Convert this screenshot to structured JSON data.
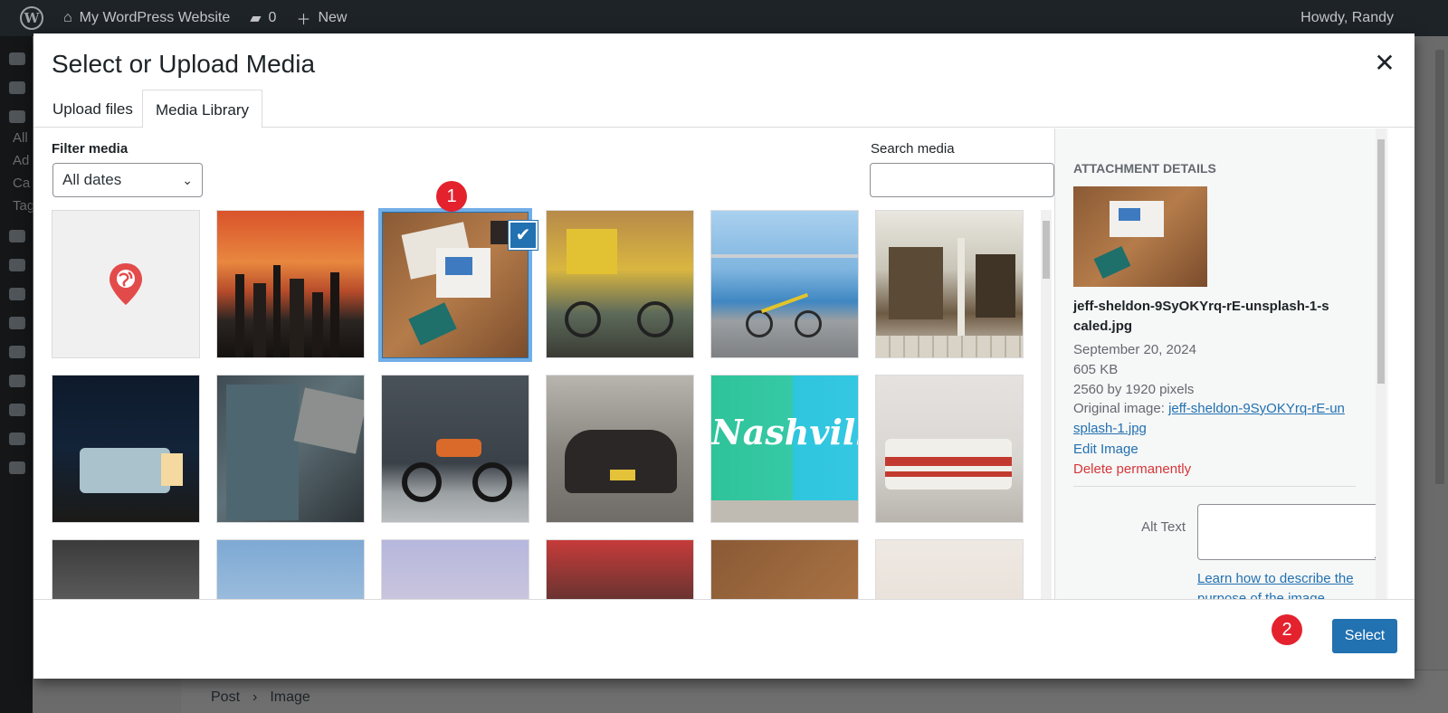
{
  "admin_bar": {
    "site_name": "My WordPress Website",
    "comments_count": "0",
    "new_label": "New",
    "howdy": "Howdy, Randy"
  },
  "sidebar": {
    "items": [
      "All",
      "Ad",
      "Ca",
      "Tag"
    ]
  },
  "breadcrumb": {
    "parent": "Post",
    "separator": "›",
    "current": "Image"
  },
  "modal": {
    "title": "Select or Upload Media",
    "close_icon": "close-icon",
    "tabs": [
      {
        "label": "Upload files",
        "active": false
      },
      {
        "label": "Media Library",
        "active": true
      }
    ]
  },
  "filters": {
    "filter_label": "Filter media",
    "date_selected": "All dates",
    "search_label": "Search media",
    "search_value": ""
  },
  "grid": {
    "thumbnails": [
      {
        "name": "map-pin-placeholder",
        "selected": false
      },
      {
        "name": "city-sunset",
        "selected": false
      },
      {
        "name": "desk-flatlay",
        "selected": true
      },
      {
        "name": "bicycle-wall",
        "selected": false
      },
      {
        "name": "bicycle-pier",
        "selected": false
      },
      {
        "name": "storefront-bikes",
        "selected": false
      },
      {
        "name": "camper-night",
        "selected": false
      },
      {
        "name": "rusty-truck",
        "selected": false
      },
      {
        "name": "motorcycle",
        "selected": false
      },
      {
        "name": "vintage-car",
        "selected": false
      },
      {
        "name": "nashville-mural",
        "selected": false
      },
      {
        "name": "red-camper",
        "selected": false
      },
      {
        "name": "street-bw",
        "selected": false
      },
      {
        "name": "motorbike-sky",
        "selected": false
      },
      {
        "name": "car-pastel",
        "selected": false
      },
      {
        "name": "yellow-taxi",
        "selected": false
      },
      {
        "name": "desk-flatlay-copy",
        "selected": false
      },
      {
        "name": "candle",
        "selected": false
      }
    ]
  },
  "details": {
    "heading": "Attachment Details",
    "filename": "jeff-sheldon-9SyOKYrq-rE-unsplash-1-scaled.jpg",
    "date": "September 20, 2024",
    "size": "605 KB",
    "dimensions": "2560 by 1920 pixels",
    "original_label": "Original image:",
    "original_link": "jeff-sheldon-9SyOKYrq-rE-unsplash-1.jpg",
    "edit_label": "Edit Image",
    "delete_label": "Delete permanently",
    "alt_label": "Alt Text",
    "alt_value": "",
    "alt_help_link": "Learn how to describe the purpose of the image. Leave"
  },
  "toolbar": {
    "select_label": "Select"
  },
  "steps": [
    "1",
    "2"
  ]
}
